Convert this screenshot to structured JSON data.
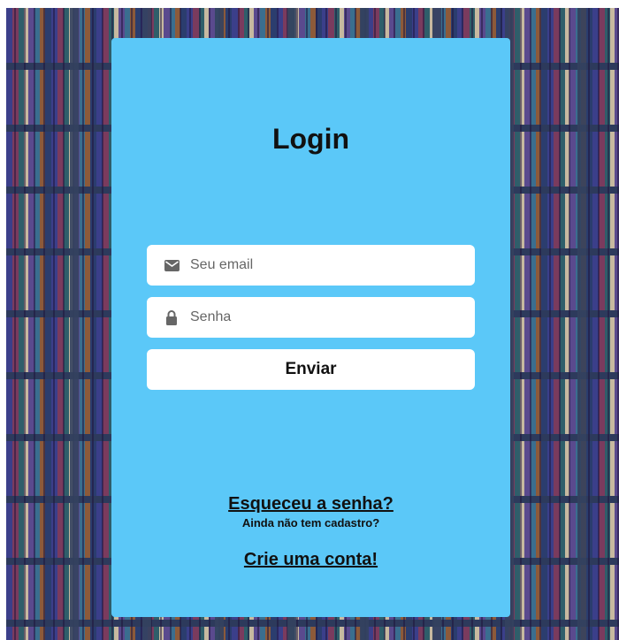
{
  "login": {
    "title": "Login",
    "email": {
      "placeholder": "Seu email",
      "value": "",
      "icon": "envelope-icon"
    },
    "password": {
      "placeholder": "Senha",
      "value": "",
      "icon": "lock-icon"
    },
    "submit_label": "Enviar",
    "forgot_password": "Esqueceu a senha?",
    "no_account_text": "Ainda não tem cadastro?",
    "create_account": "Crie uma conta!"
  },
  "colors": {
    "card_background": "#5bc8f8",
    "field_background": "#ffffff",
    "text": "#111111",
    "icon": "#666666"
  }
}
